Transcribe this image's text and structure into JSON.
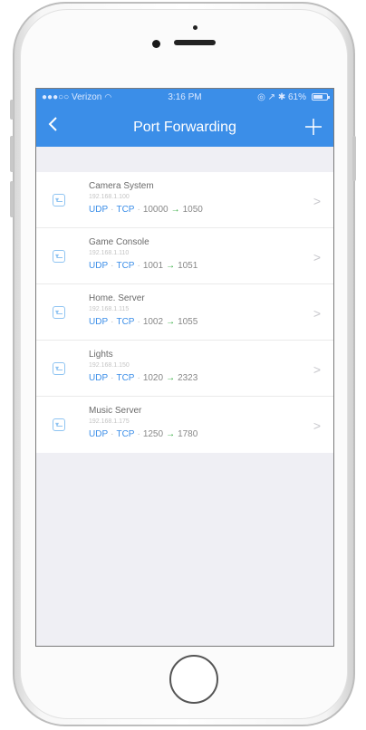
{
  "status_bar": {
    "carrier": "●●●○○ Verizon",
    "wifi_icon": "wifi-icon",
    "time": "3:16 PM",
    "right": "◎ ↗ ✱ 61%"
  },
  "nav": {
    "back_icon": "chevron-left-icon",
    "title": "Port Forwarding",
    "add_icon": "plus-icon"
  },
  "colors": {
    "nav_bg": "#3b8ee8",
    "protocol": "#3b8ee8",
    "arrow": "#2faa3b"
  },
  "devices": [
    {
      "name": "Camera System",
      "ip": "192.168.1.100",
      "protocol_a": "UDP",
      "protocol_b": "TCP",
      "external": "10000",
      "arrow": "→",
      "internal": "1050",
      "chevron": ">"
    },
    {
      "name": "Game Console",
      "ip": "192.168.1.110",
      "protocol_a": "UDP",
      "protocol_b": "TCP",
      "external": "1001",
      "arrow": "→",
      "internal": "1051",
      "chevron": ">"
    },
    {
      "name": "Home. Server",
      "ip": "192.168.1.115",
      "protocol_a": "UDP",
      "protocol_b": "TCP",
      "external": "1002",
      "arrow": "→",
      "internal": "1055",
      "chevron": ">"
    },
    {
      "name": "Lights",
      "ip": "192.168.1.150",
      "protocol_a": "UDP",
      "protocol_b": "TCP",
      "external": "1020",
      "arrow": "→",
      "internal": "2323",
      "chevron": ">"
    },
    {
      "name": "Music Server",
      "ip": "192.168.1.175",
      "protocol_a": "UDP",
      "protocol_b": "TCP",
      "external": "1250",
      "arrow": "→",
      "internal": "1780",
      "chevron": ">"
    }
  ]
}
